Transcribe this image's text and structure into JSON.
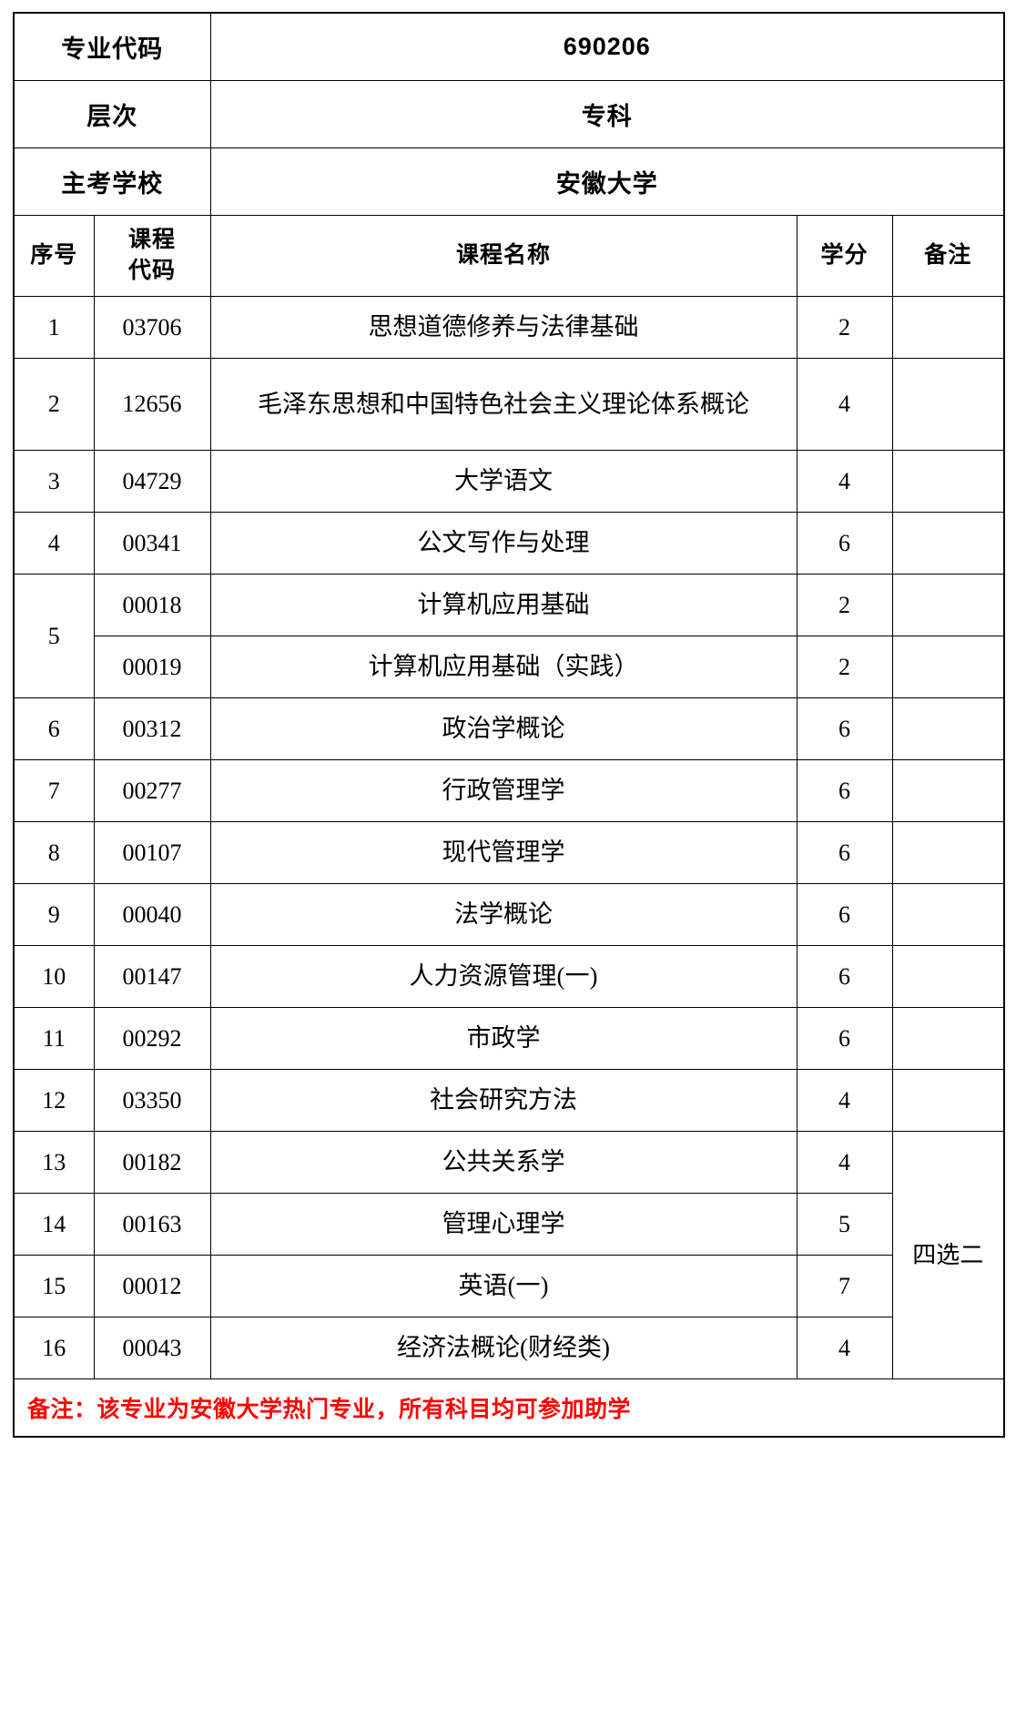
{
  "document": {
    "type": "course-plan-table",
    "colors": {
      "text": "#000000",
      "border": "#000000",
      "note": "#ff0000",
      "background": "#ffffff"
    }
  },
  "info": [
    {
      "label": "专业代码",
      "value": "690206"
    },
    {
      "label": "层次",
      "value": "专科"
    },
    {
      "label": "主考学校",
      "value": "安徽大学"
    }
  ],
  "table": {
    "headers": {
      "seq": "序号",
      "code_line1": "课程",
      "code_line2": "代码",
      "name": "课程名称",
      "credit": "学分",
      "remark": "备注"
    },
    "rows": [
      {
        "seq": "1",
        "code": "03706",
        "name": "思想道德修养与法律基础",
        "credit": "2",
        "remark": ""
      },
      {
        "seq": "2",
        "code": "12656",
        "name": "毛泽东思想和中国特色社会主义理论体系概论",
        "credit": "4",
        "remark": ""
      },
      {
        "seq": "3",
        "code": "04729",
        "name": "大学语文",
        "credit": "4",
        "remark": ""
      },
      {
        "seq": "4",
        "code": "00341",
        "name": "公文写作与处理",
        "credit": "6",
        "remark": ""
      },
      {
        "seq": "5",
        "code": "00018",
        "name": "计算机应用基础",
        "credit": "2",
        "remark": ""
      },
      {
        "seq": "",
        "code": "00019",
        "name": "计算机应用基础（实践）",
        "credit": "2",
        "remark": ""
      },
      {
        "seq": "6",
        "code": "00312",
        "name": "政治学概论",
        "credit": "6",
        "remark": ""
      },
      {
        "seq": "7",
        "code": "00277",
        "name": "行政管理学",
        "credit": "6",
        "remark": ""
      },
      {
        "seq": "8",
        "code": "00107",
        "name": "现代管理学",
        "credit": "6",
        "remark": ""
      },
      {
        "seq": "9",
        "code": "00040",
        "name": "法学概论",
        "credit": "6",
        "remark": ""
      },
      {
        "seq": "10",
        "code": "00147",
        "name": "人力资源管理(一)",
        "credit": "6",
        "remark": ""
      },
      {
        "seq": "11",
        "code": "00292",
        "name": "市政学",
        "credit": "6",
        "remark": ""
      },
      {
        "seq": "12",
        "code": "03350",
        "name": "社会研究方法",
        "credit": "4",
        "remark": ""
      },
      {
        "seq": "13",
        "code": "00182",
        "name": "公共关系学",
        "credit": "4",
        "remark": "四选二"
      },
      {
        "seq": "14",
        "code": "00163",
        "name": "管理心理学",
        "credit": "5",
        "remark": ""
      },
      {
        "seq": "15",
        "code": "00012",
        "name": "英语(一)",
        "credit": "7",
        "remark": ""
      },
      {
        "seq": "16",
        "code": "00043",
        "name": "经济法概论(财经类)",
        "credit": "4",
        "remark": ""
      }
    ],
    "merged_remark": "四选二",
    "merged_seq_5": "5"
  },
  "footnote": {
    "text": "备注：该专业为安徽大学热门专业，所有科目均可参加助学"
  }
}
